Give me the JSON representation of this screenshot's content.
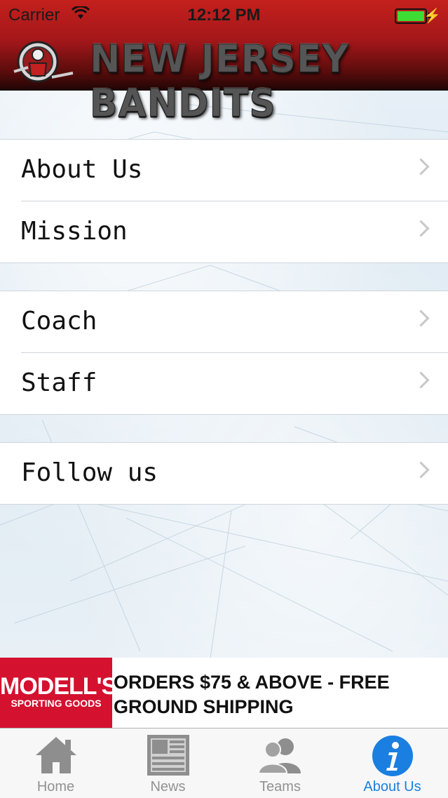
{
  "status_bar": {
    "carrier": "Carrier",
    "time": "12:12 PM",
    "battery_color": "#3ddc34"
  },
  "header": {
    "title": "NEW JERSEY BANDITS",
    "logo_icon": "bandits-logo-icon",
    "background_color": "#a4171a"
  },
  "sections": [
    {
      "items": [
        {
          "label": "About Us"
        },
        {
          "label": "Mission"
        }
      ]
    },
    {
      "items": [
        {
          "label": "Coach"
        },
        {
          "label": "Staff"
        }
      ]
    },
    {
      "items": [
        {
          "label": "Follow us"
        }
      ]
    }
  ],
  "ad": {
    "brand_main": "MODELL'S",
    "brand_sub": "SPORTING GOODS",
    "line1": "ORDERS $75 & ABOVE - FREE",
    "line2": "GROUND SHIPPING",
    "brand_color": "#d4112f"
  },
  "tabbar": {
    "tabs": [
      {
        "label": "Home",
        "icon": "home-icon",
        "active": false
      },
      {
        "label": "News",
        "icon": "news-icon",
        "active": false
      },
      {
        "label": "Teams",
        "icon": "teams-icon",
        "active": false
      },
      {
        "label": "About Us",
        "icon": "info-icon",
        "active": true
      }
    ],
    "active_color": "#1a7fe0",
    "inactive_color": "#929292"
  }
}
